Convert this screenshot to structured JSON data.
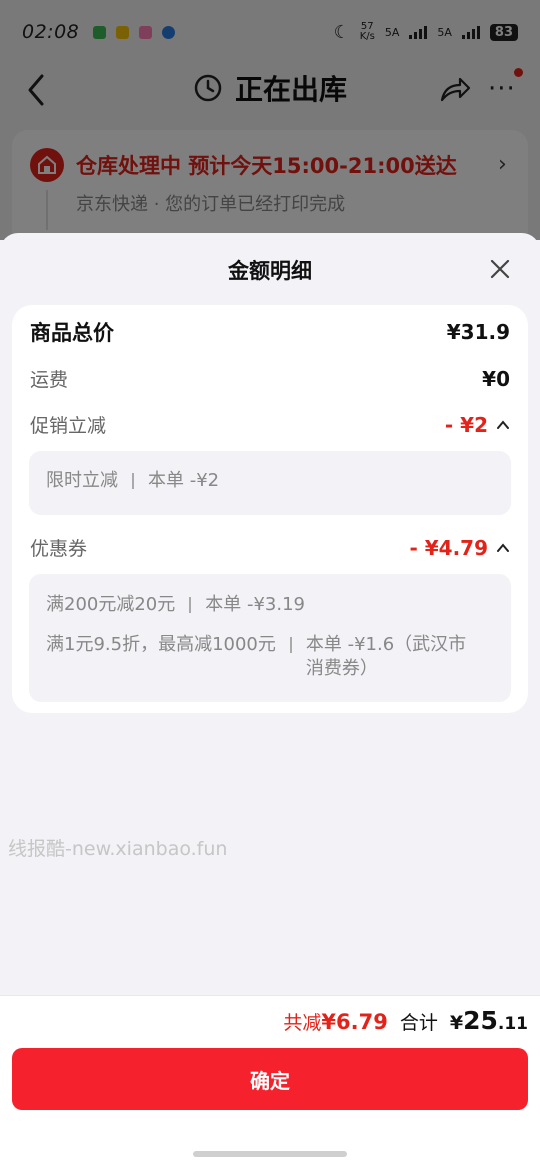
{
  "status_bar": {
    "time": "02:08",
    "net_speed_top": "57",
    "net_speed_bottom": "K/s",
    "sim1": "5A",
    "sim2": "5A",
    "battery": "83"
  },
  "nav": {
    "title": "正在出库",
    "icons": {
      "back": "chevron-left-icon",
      "clock": "clock-icon",
      "share": "share-icon",
      "more": "more-icon"
    }
  },
  "order_status": {
    "title": "仓库处理中 预计今天15:00-21:00送达",
    "subtitle": "京东快递 · 您的订单已经打印完成"
  },
  "sheet": {
    "title": "金额明细",
    "goods_total": {
      "label": "商品总价",
      "value": "¥31.9"
    },
    "shipping": {
      "label": "运费",
      "value": "¥0"
    },
    "promotion": {
      "label": "促销立减",
      "value": "- ¥2",
      "items": [
        {
          "name": "限时立减",
          "detail": "本单 -¥2"
        }
      ]
    },
    "coupon": {
      "label": "优惠券",
      "value": "- ¥4.79",
      "items": [
        {
          "name": "满200元减20元",
          "detail": "本单 -¥3.19"
        },
        {
          "name": "满1元9.5折，最高减1000元",
          "detail": "本单 -¥1.6（武汉市消费券）"
        }
      ]
    },
    "watermark": "线报酷-new.xianbao.fun",
    "footer": {
      "saved_label": "共减",
      "saved_value": "¥6.79",
      "total_label": "合计",
      "total_yen": "¥",
      "total_int": "25",
      "total_dec": ".11",
      "confirm_label": "确定"
    }
  },
  "colors": {
    "accent": "#e2231a",
    "button": "#f5222d"
  }
}
